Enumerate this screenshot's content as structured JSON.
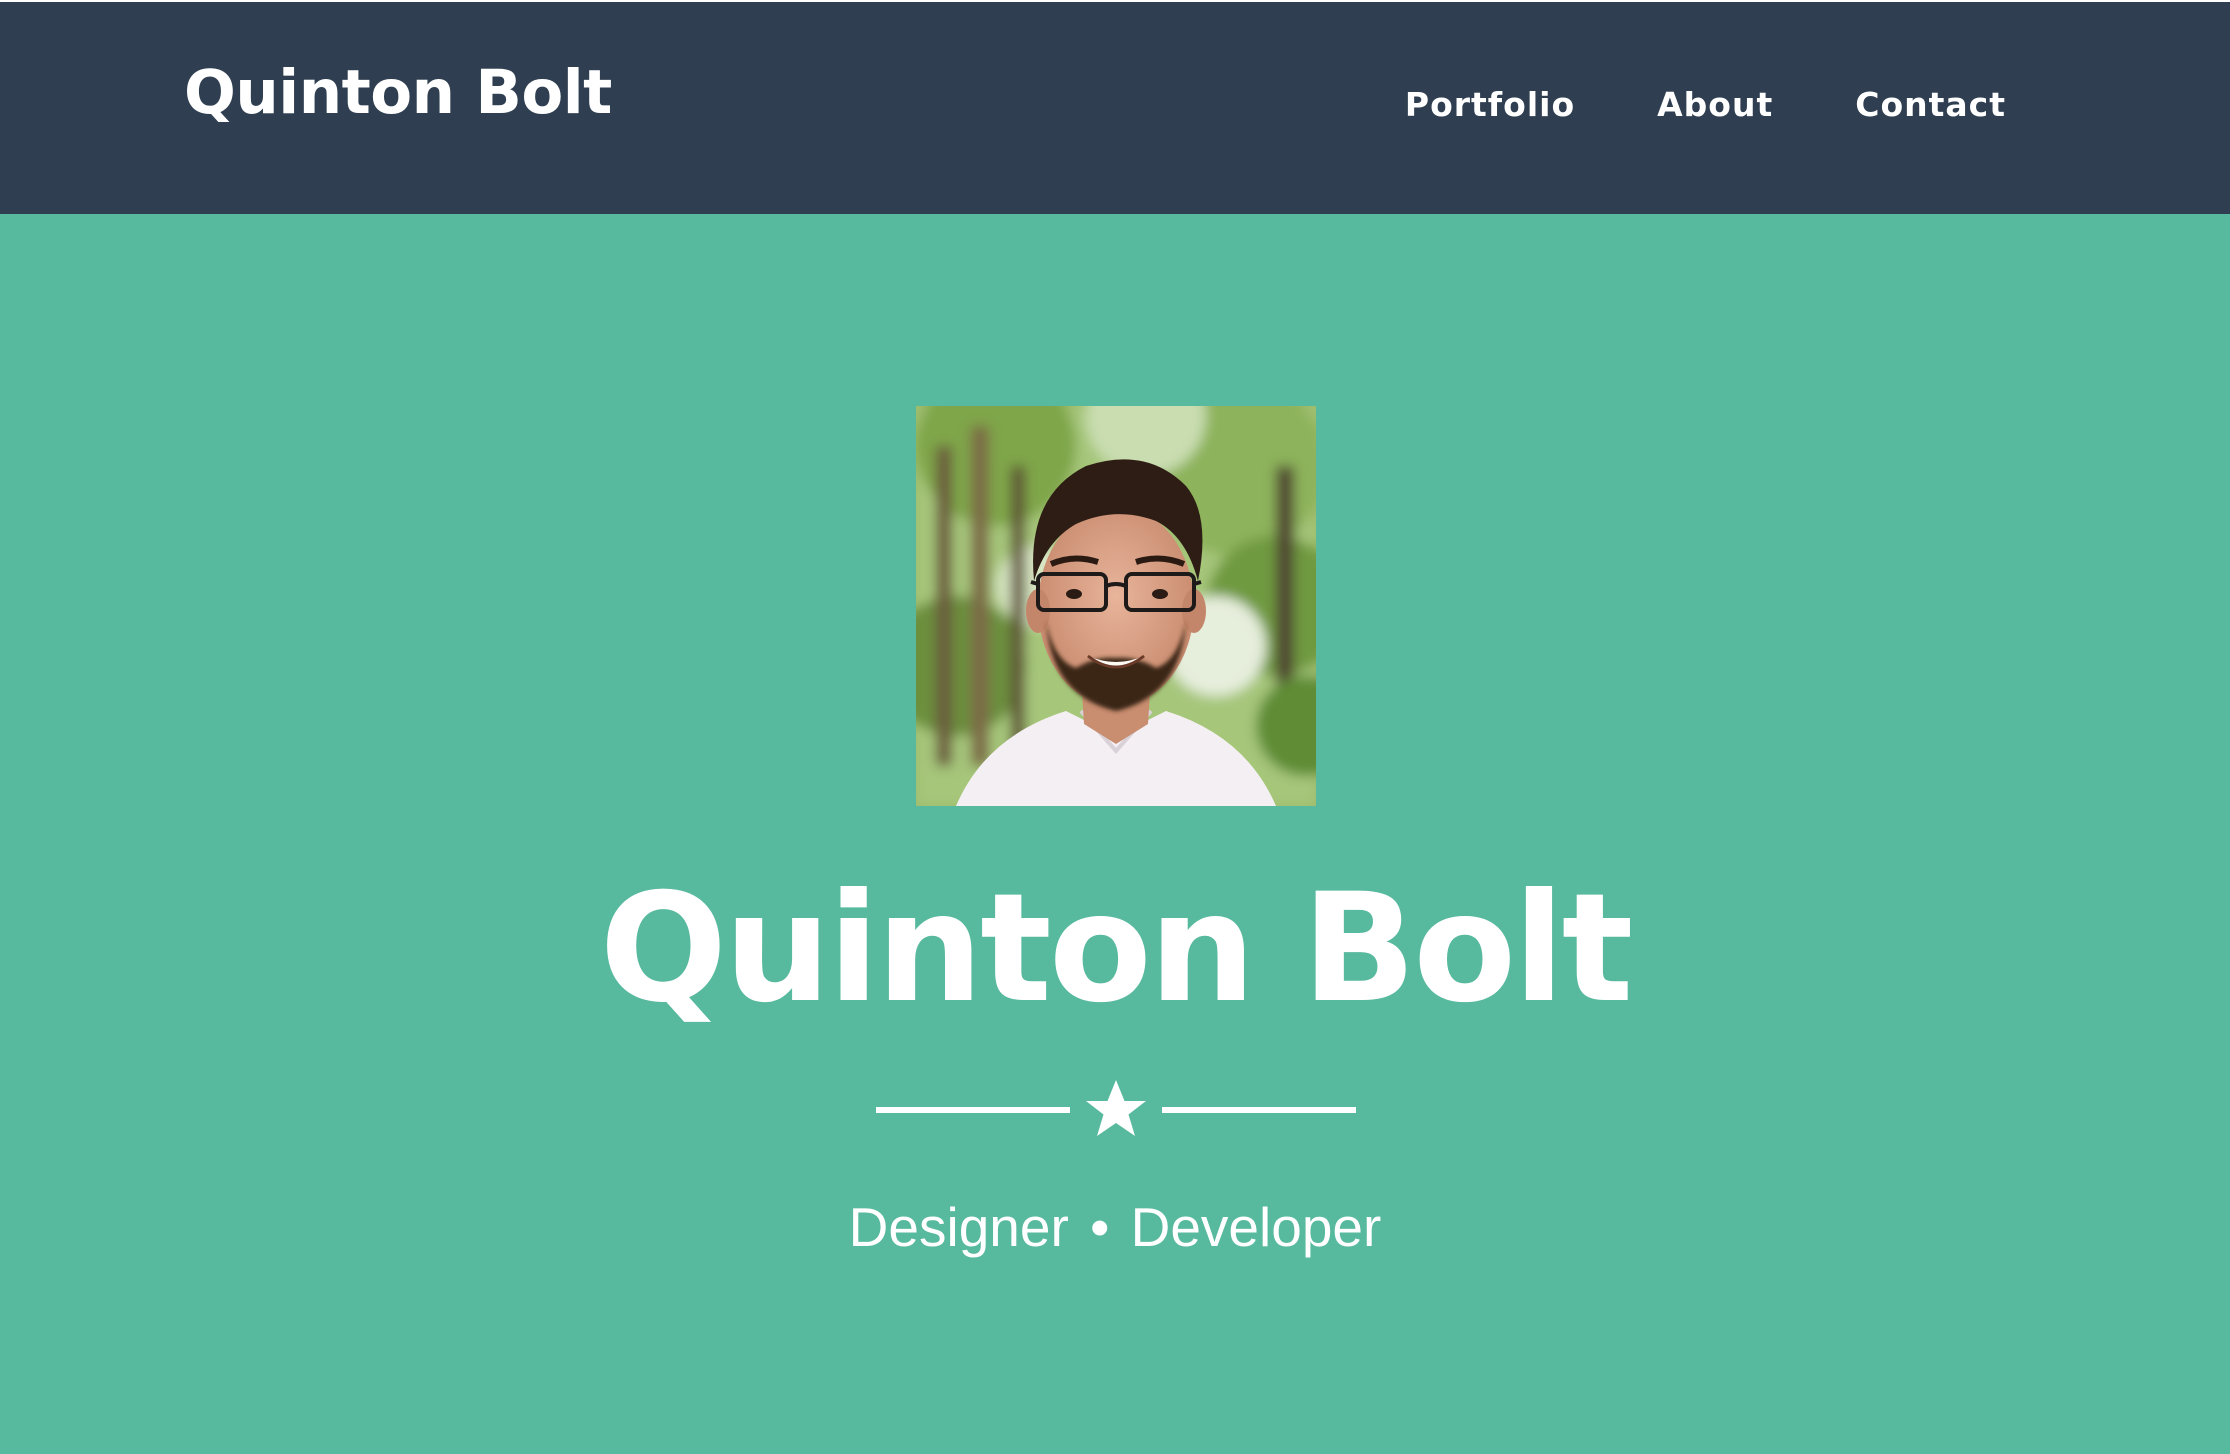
{
  "navbar": {
    "brand": "Quinton Bolt",
    "links": [
      {
        "label": "Portfolio"
      },
      {
        "label": "About"
      },
      {
        "label": "Contact"
      }
    ]
  },
  "hero": {
    "title": "Quinton Bolt",
    "subtitle_left": "Designer",
    "subtitle_sep": "•",
    "subtitle_right": "Developer"
  },
  "icons": {
    "divider": "star-icon"
  },
  "colors": {
    "navbar_bg": "#2f3e50",
    "hero_bg": "#57b99d",
    "text": "#ffffff"
  }
}
